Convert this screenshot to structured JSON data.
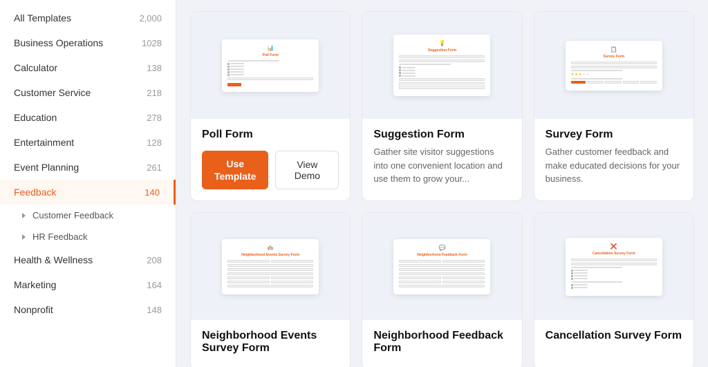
{
  "sidebar": {
    "items": [
      {
        "id": "all-templates",
        "label": "All Templates",
        "count": "2,000",
        "active": false
      },
      {
        "id": "business-operations",
        "label": "Business Operations",
        "count": "1028",
        "active": false
      },
      {
        "id": "calculator",
        "label": "Calculator",
        "count": "138",
        "active": false
      },
      {
        "id": "customer-service",
        "label": "Customer Service",
        "count": "218",
        "active": false
      },
      {
        "id": "education",
        "label": "Education",
        "count": "278",
        "active": false
      },
      {
        "id": "entertainment",
        "label": "Entertainment",
        "count": "128",
        "active": false
      },
      {
        "id": "event-planning",
        "label": "Event Planning",
        "count": "261",
        "active": false
      },
      {
        "id": "feedback",
        "label": "Feedback",
        "count": "140",
        "active": true
      },
      {
        "id": "health-wellness",
        "label": "Health & Wellness",
        "count": "208",
        "active": false
      },
      {
        "id": "marketing",
        "label": "Marketing",
        "count": "164",
        "active": false
      },
      {
        "id": "nonprofit",
        "label": "Nonprofit",
        "count": "148",
        "active": false
      }
    ],
    "sub_items": [
      {
        "id": "customer-feedback",
        "label": "Customer Feedback"
      },
      {
        "id": "hr-feedback",
        "label": "HR Feedback"
      }
    ]
  },
  "cards": [
    {
      "id": "poll-form",
      "title": "Poll Form",
      "description": null,
      "has_inline_actions": true,
      "btn_use_template": "Use\nTemplate",
      "btn_view_demo": "View Demo",
      "type": "poll"
    },
    {
      "id": "suggestion-form",
      "title": "Suggestion Form",
      "description": "Gather site visitor suggestions into one convenient location and use them to grow your...",
      "has_inline_actions": false,
      "type": "suggestion"
    },
    {
      "id": "survey-form",
      "title": "Survey Form",
      "description": "Gather customer feedback and make educated decisions for your business.",
      "has_inline_actions": false,
      "type": "survey"
    },
    {
      "id": "neighborhood-events",
      "title": "Neighborhood Events Survey Form",
      "description": null,
      "has_inline_actions": false,
      "type": "neighborhood-events"
    },
    {
      "id": "neighborhood-feedback",
      "title": "Neighborhood Feedback Form",
      "description": null,
      "has_inline_actions": false,
      "type": "neighborhood-feedback"
    },
    {
      "id": "cancellation-survey",
      "title": "Cancellation Survey Form",
      "description": null,
      "has_inline_actions": false,
      "type": "cancellation"
    }
  ]
}
